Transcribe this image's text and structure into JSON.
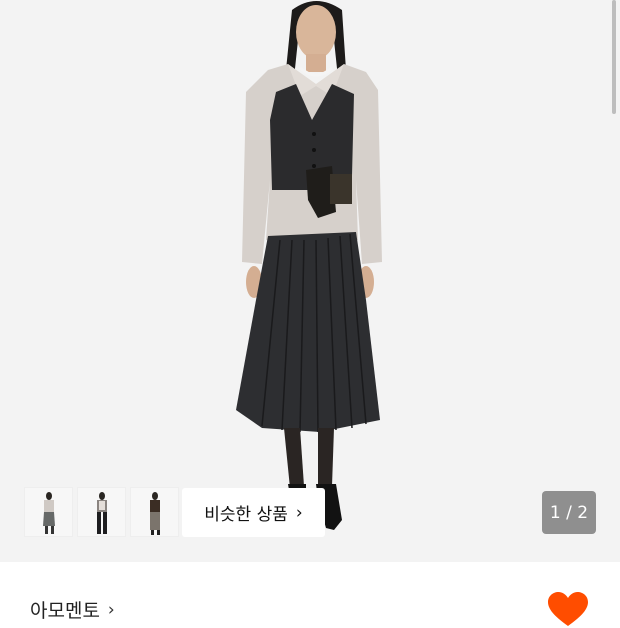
{
  "gallery": {
    "similar_button_label": "비슷한 상품",
    "page_counter": "1 / 2",
    "thumbnails": [
      {
        "name": "thumbnail-1"
      },
      {
        "name": "thumbnail-2"
      },
      {
        "name": "thumbnail-3"
      }
    ]
  },
  "product": {
    "brand_name": "아모멘토",
    "wishlist_icon": "heart-icon",
    "wishlist_color": "#ff4d00"
  },
  "colors": {
    "hero_background": "#f3f3f3",
    "accent": "#ff4d00"
  }
}
